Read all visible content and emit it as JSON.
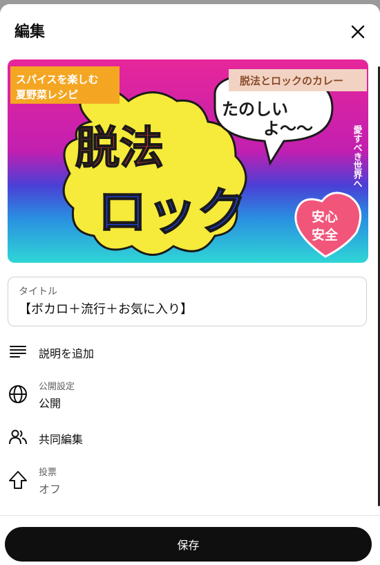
{
  "header": {
    "title": "編集",
    "close_icon": "close-icon"
  },
  "thumbnail": {
    "top_left_line1": "スパイスを楽しむ",
    "top_left_line2": "夏野菜レシピ",
    "top_right": "脱法とロックのカレー",
    "main_line1": "脱法",
    "main_line2": "ロック",
    "bubble_line1": "たのしい",
    "bubble_line2": "よ〜〜",
    "vertical": "愛すべき世界へ",
    "badge_line1": "安心",
    "badge_line2": "安全",
    "colors": {
      "bg_top": "#e7269a",
      "bg_mid": "#6a3fd0",
      "bg_bottom": "#2fd6d6",
      "blob": "#f6ea3a"
    }
  },
  "title_field": {
    "label": "タイトル",
    "value": "【ボカロ＋流行＋お気に入り】"
  },
  "rows": {
    "description": {
      "label": "説明を追加",
      "icon": "description-icon"
    },
    "visibility": {
      "label": "公開設定",
      "value": "公開",
      "icon": "globe-icon"
    },
    "collaborate": {
      "label": "共同編集",
      "icon": "people-icon"
    },
    "voting": {
      "label": "投票",
      "value": "オフ",
      "icon": "upvote-icon"
    }
  },
  "save_button": {
    "label": "保存"
  }
}
